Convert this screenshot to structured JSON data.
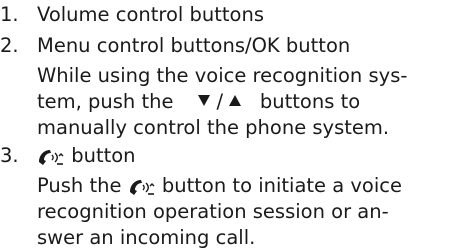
{
  "items": [
    {
      "number": "1.",
      "title": "Volume control buttons"
    },
    {
      "number": "2.",
      "title": "Menu control buttons/OK button",
      "description": {
        "line1": "While using the voice recognition sys-",
        "line2_before": "tem, push the",
        "separator": "/",
        "line2_after": "buttons to",
        "line3": "manually control the phone system."
      }
    },
    {
      "number": "3.",
      "title_suffix": "button",
      "description": {
        "line1_before": "Push the",
        "line1_after": "button to initiate a voice",
        "line2": "recognition operation session or an-",
        "line3": "swer an incoming call."
      }
    }
  ],
  "icons": {
    "phone_voice": "phone-voice-icon",
    "down": "triangle-down-icon",
    "up": "triangle-up-icon"
  },
  "colors": {
    "text": "#1a1a1a",
    "background": "#ffffff"
  }
}
